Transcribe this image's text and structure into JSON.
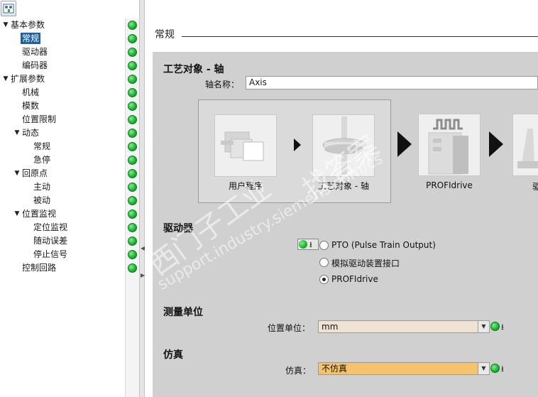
{
  "tree": {
    "items": [
      {
        "label": "基本参数",
        "level": 0,
        "expanded": true
      },
      {
        "label": "常规",
        "level": 1,
        "selected": true
      },
      {
        "label": "驱动器",
        "level": 1
      },
      {
        "label": "编码器",
        "level": 1
      },
      {
        "label": "扩展参数",
        "level": 0,
        "expanded": true
      },
      {
        "label": "机械",
        "level": 1
      },
      {
        "label": "模数",
        "level": 1
      },
      {
        "label": "位置限制",
        "level": 1
      },
      {
        "label": "动态",
        "level": 1,
        "expanded": true
      },
      {
        "label": "常规",
        "level": 2
      },
      {
        "label": "急停",
        "level": 2
      },
      {
        "label": "回原点",
        "level": 1,
        "expanded": true
      },
      {
        "label": "主动",
        "level": 2
      },
      {
        "label": "被动",
        "level": 2
      },
      {
        "label": "位置监视",
        "level": 1,
        "expanded": true
      },
      {
        "label": "定位监视",
        "level": 2
      },
      {
        "label": "随动误差",
        "level": 2
      },
      {
        "label": "停止信号",
        "level": 2
      },
      {
        "label": "控制回路",
        "level": 1
      }
    ]
  },
  "header": {
    "title": "常规"
  },
  "tech_object": {
    "heading": "工艺对象 - 轴",
    "axis_name_label": "轴名称：",
    "axis_name_value": "Axis"
  },
  "flow": {
    "user_program": "用户程序",
    "tech_object_axis": "工艺对象 - 轴",
    "profidrive": "PROFIdrive",
    "drive_partial": "驱"
  },
  "drive": {
    "heading": "驱动器",
    "options": [
      {
        "label": "PTO (Pulse Train Output)",
        "selected": false
      },
      {
        "label": "模拟驱动装置接口",
        "selected": false
      },
      {
        "label": "PROFIdrive",
        "selected": true
      }
    ]
  },
  "units": {
    "heading": "测量单位",
    "position_unit_label": "位置单位：",
    "position_unit_value": "mm"
  },
  "simulation": {
    "heading": "仿真",
    "label": "仿真：",
    "value": "不仿真"
  },
  "download_glyph": "⭳",
  "watermark": {
    "line1": "西门子工业",
    "line2": "support.industry.siemens.com/cs",
    "line3": "找答案"
  },
  "colors": {
    "panel_bg": "#d0d0d0",
    "selection": "#1e5fa8",
    "status_ok": "#1fb634",
    "sim_field": "#f6c26c",
    "unit_field": "#efe4d4"
  }
}
